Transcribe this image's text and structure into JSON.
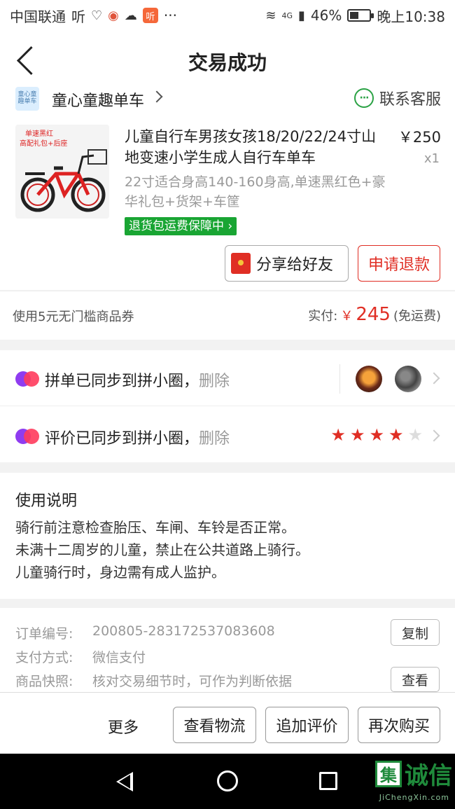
{
  "status_bar": {
    "carrier": "中国联通",
    "carrier_app": "听",
    "extra_badge": "听",
    "more": "···",
    "network": "4G",
    "battery": "46%",
    "battery_level": 0.46,
    "time": "晚上10:38"
  },
  "header": {
    "title": "交易成功"
  },
  "shop": {
    "logo_text": "童心童趣单车",
    "name": "童心童趣单车",
    "contact_label": "联系客服",
    "contact_icon_glyph": "···"
  },
  "product": {
    "image_caption_line1": "单速黑红",
    "image_caption_line2": "高配礼包+后座",
    "title": "儿童自行车男孩女孩18/20/22/24寸山地变速小学生成人自行车单车",
    "price": "￥250",
    "quantity": "x1",
    "spec": "22寸适合身高140-160身高,单速黑红色+豪华礼包+货架+车筐",
    "guarantee": "退货包运费保障中 ›"
  },
  "actions": {
    "share": "分享给好友",
    "refund": "申请退款"
  },
  "payment": {
    "coupon": "使用5元无门槛商品券",
    "paid_label": "实付:",
    "currency": "￥",
    "amount": "245",
    "shipping_note": "(免运费)"
  },
  "sync": {
    "order_text": "拼单已同步到拼小圈，",
    "review_text": "评价已同步到拼小圈，",
    "delete_label": "删除",
    "rating": 4,
    "rating_max": 5
  },
  "usage": {
    "title": "使用说明",
    "lines": [
      "骑行前注意检查胎压、车闸、车铃是否正常。",
      "未满十二周岁的儿童，禁止在公共道路上骑行。",
      "儿童骑行时，身边需有成人监护。"
    ]
  },
  "order_info": {
    "order_no_label": "订单编号:",
    "order_no": "200805-283172537083608",
    "copy_label": "复制",
    "pay_method_label": "支付方式:",
    "pay_method": "微信支付",
    "snapshot_label": "商品快照:",
    "snapshot_desc": "核对交易细节时，可作为判断依据",
    "view_label": "查看"
  },
  "bottom_bar": {
    "more": "更多",
    "logistics": "查看物流",
    "add_review": "追加评价",
    "buy_again": "再次购买"
  },
  "watermark": {
    "mark": "集",
    "text": "诚信",
    "sub": "JiChengXin.com"
  },
  "colors": {
    "accent_red": "#e02e24",
    "guarantee_green": "#19a533",
    "service_green": "#2ba245"
  }
}
